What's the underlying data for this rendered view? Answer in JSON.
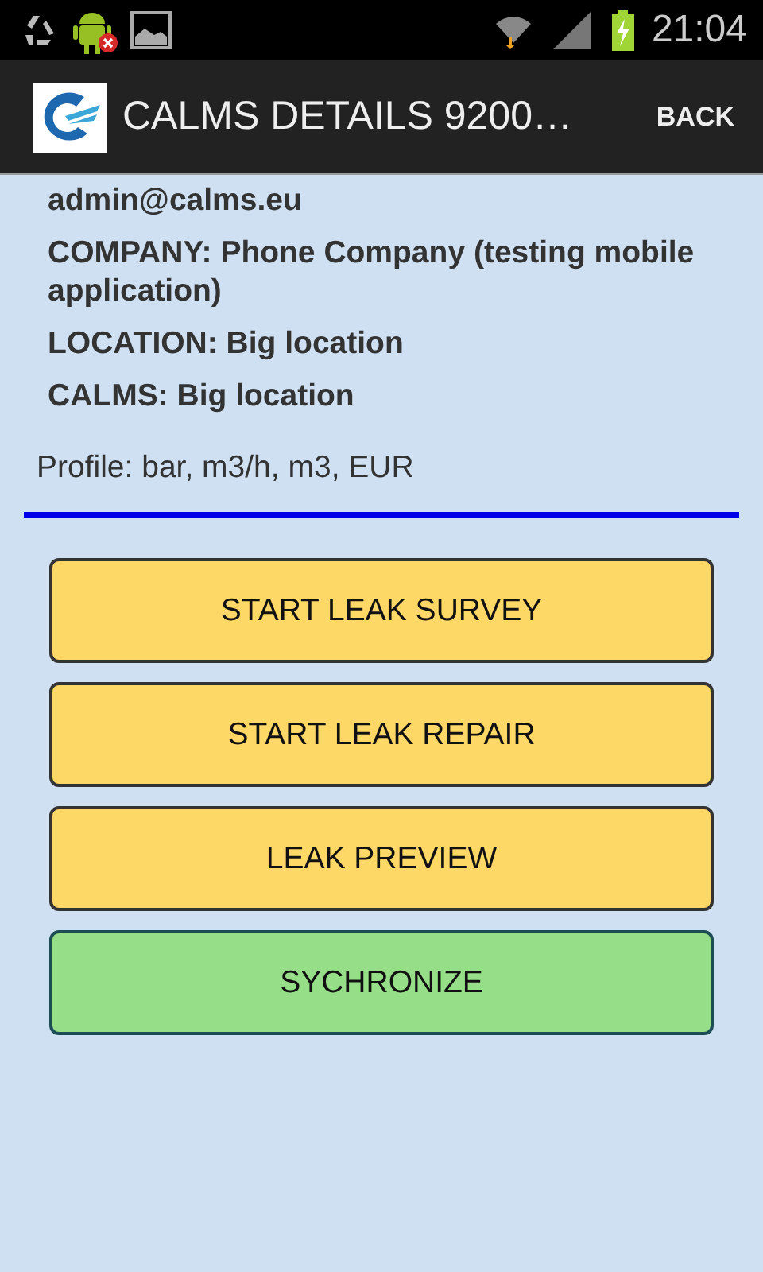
{
  "status_bar": {
    "time": "21:04"
  },
  "action_bar": {
    "title": "CALMS DETAILS  9200…",
    "back": "BACK"
  },
  "details": [
    "admin@calms.eu",
    "COMPANY: Phone Company (testing mobile application)",
    "LOCATION: Big location",
    "CALMS: Big location"
  ],
  "profile": "Profile: bar, m3/h, m3, EUR",
  "buttons": [
    {
      "label": "START LEAK SURVEY",
      "kind": "action"
    },
    {
      "label": "START LEAK REPAIR",
      "kind": "action"
    },
    {
      "label": "LEAK PREVIEW",
      "kind": "action"
    },
    {
      "label": "SYCHRONIZE",
      "kind": "sync"
    }
  ]
}
